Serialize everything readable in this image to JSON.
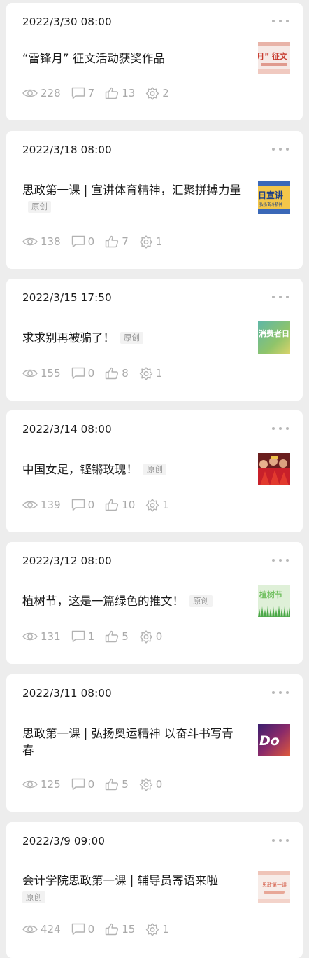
{
  "articles": [
    {
      "date": "2022/3/30 08:00",
      "title": "“雷锋月” 征文活动获奖作品",
      "tag": "",
      "views": "228",
      "comments": "7",
      "likes": "13",
      "shares": "2"
    },
    {
      "date": "2022/3/18 08:00",
      "title": "思政第一课 | 宣讲体育精神，汇聚拼搏力量",
      "tag": "原创",
      "views": "138",
      "comments": "0",
      "likes": "7",
      "shares": "1"
    },
    {
      "date": "2022/3/15 17:50",
      "title": "求求别再被骗了！",
      "tag": "原创",
      "views": "155",
      "comments": "0",
      "likes": "8",
      "shares": "1"
    },
    {
      "date": "2022/3/14 08:00",
      "title": "中国女足，铿锵玫瑰！",
      "tag": "原创",
      "views": "139",
      "comments": "0",
      "likes": "10",
      "shares": "1"
    },
    {
      "date": "2022/3/12 08:00",
      "title": "植树节，这是一篇绿色的推文！",
      "tag": "原创",
      "views": "131",
      "comments": "1",
      "likes": "5",
      "shares": "0"
    },
    {
      "date": "2022/3/11 08:00",
      "title": "思政第一课 | 弘扬奥运精神 以奋斗书写青春",
      "tag": "",
      "views": "125",
      "comments": "0",
      "likes": "5",
      "shares": "0"
    },
    {
      "date": "2022/3/9 09:00",
      "title": "会计学院思政第一课 | 辅导员寄语来啦",
      "tag": "原创",
      "views": "424",
      "comments": "0",
      "likes": "15",
      "shares": "1"
    }
  ],
  "thumbs": {
    "t1": "月” 征文",
    "t2": "日宣讲",
    "t2b": "弘扬奋斗精神",
    "t3": "消费者日",
    "t5": "植树节",
    "t6": "Do",
    "t7": "思政第一课"
  },
  "colors": {
    "background": "#ededed",
    "card": "#ffffff",
    "text": "#1a1a1a",
    "meta": "#a9a9a9",
    "tag_bg": "#f2f2f2"
  }
}
